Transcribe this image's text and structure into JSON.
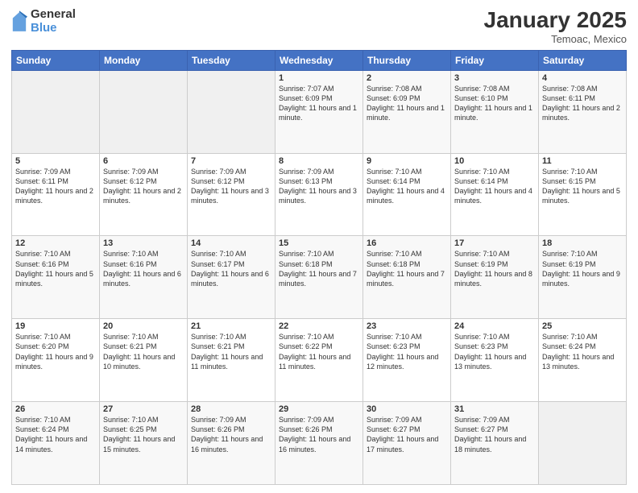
{
  "logo": {
    "general": "General",
    "blue": "Blue"
  },
  "title": "January 2025",
  "location": "Temoac, Mexico",
  "days_of_week": [
    "Sunday",
    "Monday",
    "Tuesday",
    "Wednesday",
    "Thursday",
    "Friday",
    "Saturday"
  ],
  "weeks": [
    [
      {
        "day": "",
        "sunrise": "",
        "sunset": "",
        "daylight": ""
      },
      {
        "day": "",
        "sunrise": "",
        "sunset": "",
        "daylight": ""
      },
      {
        "day": "",
        "sunrise": "",
        "sunset": "",
        "daylight": ""
      },
      {
        "day": "1",
        "sunrise": "Sunrise: 7:07 AM",
        "sunset": "Sunset: 6:09 PM",
        "daylight": "Daylight: 11 hours and 1 minute."
      },
      {
        "day": "2",
        "sunrise": "Sunrise: 7:08 AM",
        "sunset": "Sunset: 6:09 PM",
        "daylight": "Daylight: 11 hours and 1 minute."
      },
      {
        "day": "3",
        "sunrise": "Sunrise: 7:08 AM",
        "sunset": "Sunset: 6:10 PM",
        "daylight": "Daylight: 11 hours and 1 minute."
      },
      {
        "day": "4",
        "sunrise": "Sunrise: 7:08 AM",
        "sunset": "Sunset: 6:11 PM",
        "daylight": "Daylight: 11 hours and 2 minutes."
      }
    ],
    [
      {
        "day": "5",
        "sunrise": "Sunrise: 7:09 AM",
        "sunset": "Sunset: 6:11 PM",
        "daylight": "Daylight: 11 hours and 2 minutes."
      },
      {
        "day": "6",
        "sunrise": "Sunrise: 7:09 AM",
        "sunset": "Sunset: 6:12 PM",
        "daylight": "Daylight: 11 hours and 2 minutes."
      },
      {
        "day": "7",
        "sunrise": "Sunrise: 7:09 AM",
        "sunset": "Sunset: 6:12 PM",
        "daylight": "Daylight: 11 hours and 3 minutes."
      },
      {
        "day": "8",
        "sunrise": "Sunrise: 7:09 AM",
        "sunset": "Sunset: 6:13 PM",
        "daylight": "Daylight: 11 hours and 3 minutes."
      },
      {
        "day": "9",
        "sunrise": "Sunrise: 7:10 AM",
        "sunset": "Sunset: 6:14 PM",
        "daylight": "Daylight: 11 hours and 4 minutes."
      },
      {
        "day": "10",
        "sunrise": "Sunrise: 7:10 AM",
        "sunset": "Sunset: 6:14 PM",
        "daylight": "Daylight: 11 hours and 4 minutes."
      },
      {
        "day": "11",
        "sunrise": "Sunrise: 7:10 AM",
        "sunset": "Sunset: 6:15 PM",
        "daylight": "Daylight: 11 hours and 5 minutes."
      }
    ],
    [
      {
        "day": "12",
        "sunrise": "Sunrise: 7:10 AM",
        "sunset": "Sunset: 6:16 PM",
        "daylight": "Daylight: 11 hours and 5 minutes."
      },
      {
        "day": "13",
        "sunrise": "Sunrise: 7:10 AM",
        "sunset": "Sunset: 6:16 PM",
        "daylight": "Daylight: 11 hours and 6 minutes."
      },
      {
        "day": "14",
        "sunrise": "Sunrise: 7:10 AM",
        "sunset": "Sunset: 6:17 PM",
        "daylight": "Daylight: 11 hours and 6 minutes."
      },
      {
        "day": "15",
        "sunrise": "Sunrise: 7:10 AM",
        "sunset": "Sunset: 6:18 PM",
        "daylight": "Daylight: 11 hours and 7 minutes."
      },
      {
        "day": "16",
        "sunrise": "Sunrise: 7:10 AM",
        "sunset": "Sunset: 6:18 PM",
        "daylight": "Daylight: 11 hours and 7 minutes."
      },
      {
        "day": "17",
        "sunrise": "Sunrise: 7:10 AM",
        "sunset": "Sunset: 6:19 PM",
        "daylight": "Daylight: 11 hours and 8 minutes."
      },
      {
        "day": "18",
        "sunrise": "Sunrise: 7:10 AM",
        "sunset": "Sunset: 6:19 PM",
        "daylight": "Daylight: 11 hours and 9 minutes."
      }
    ],
    [
      {
        "day": "19",
        "sunrise": "Sunrise: 7:10 AM",
        "sunset": "Sunset: 6:20 PM",
        "daylight": "Daylight: 11 hours and 9 minutes."
      },
      {
        "day": "20",
        "sunrise": "Sunrise: 7:10 AM",
        "sunset": "Sunset: 6:21 PM",
        "daylight": "Daylight: 11 hours and 10 minutes."
      },
      {
        "day": "21",
        "sunrise": "Sunrise: 7:10 AM",
        "sunset": "Sunset: 6:21 PM",
        "daylight": "Daylight: 11 hours and 11 minutes."
      },
      {
        "day": "22",
        "sunrise": "Sunrise: 7:10 AM",
        "sunset": "Sunset: 6:22 PM",
        "daylight": "Daylight: 11 hours and 11 minutes."
      },
      {
        "day": "23",
        "sunrise": "Sunrise: 7:10 AM",
        "sunset": "Sunset: 6:23 PM",
        "daylight": "Daylight: 11 hours and 12 minutes."
      },
      {
        "day": "24",
        "sunrise": "Sunrise: 7:10 AM",
        "sunset": "Sunset: 6:23 PM",
        "daylight": "Daylight: 11 hours and 13 minutes."
      },
      {
        "day": "25",
        "sunrise": "Sunrise: 7:10 AM",
        "sunset": "Sunset: 6:24 PM",
        "daylight": "Daylight: 11 hours and 13 minutes."
      }
    ],
    [
      {
        "day": "26",
        "sunrise": "Sunrise: 7:10 AM",
        "sunset": "Sunset: 6:24 PM",
        "daylight": "Daylight: 11 hours and 14 minutes."
      },
      {
        "day": "27",
        "sunrise": "Sunrise: 7:10 AM",
        "sunset": "Sunset: 6:25 PM",
        "daylight": "Daylight: 11 hours and 15 minutes."
      },
      {
        "day": "28",
        "sunrise": "Sunrise: 7:09 AM",
        "sunset": "Sunset: 6:26 PM",
        "daylight": "Daylight: 11 hours and 16 minutes."
      },
      {
        "day": "29",
        "sunrise": "Sunrise: 7:09 AM",
        "sunset": "Sunset: 6:26 PM",
        "daylight": "Daylight: 11 hours and 16 minutes."
      },
      {
        "day": "30",
        "sunrise": "Sunrise: 7:09 AM",
        "sunset": "Sunset: 6:27 PM",
        "daylight": "Daylight: 11 hours and 17 minutes."
      },
      {
        "day": "31",
        "sunrise": "Sunrise: 7:09 AM",
        "sunset": "Sunset: 6:27 PM",
        "daylight": "Daylight: 11 hours and 18 minutes."
      },
      {
        "day": "",
        "sunrise": "",
        "sunset": "",
        "daylight": ""
      }
    ]
  ]
}
